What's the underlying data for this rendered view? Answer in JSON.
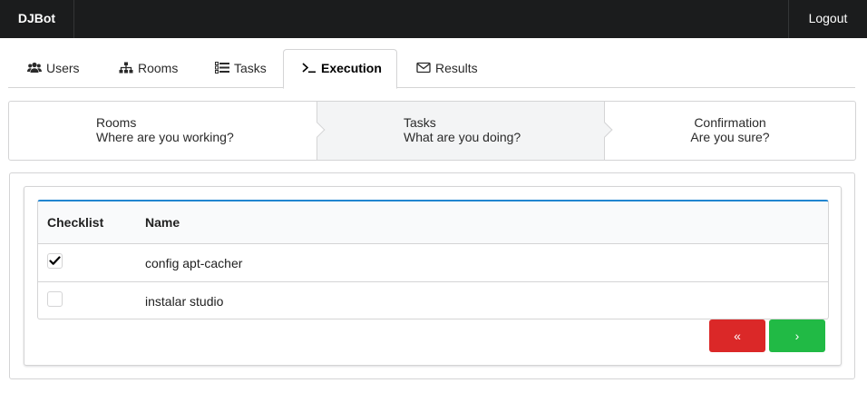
{
  "navbar": {
    "brand": "DJBot",
    "logout_label": "Logout"
  },
  "tabs": [
    {
      "label": "Users",
      "icon": "users-icon"
    },
    {
      "label": "Rooms",
      "icon": "sitemap-icon"
    },
    {
      "label": "Tasks",
      "icon": "tasks-icon"
    },
    {
      "label": "Execution",
      "icon": "terminal-icon",
      "active": true
    },
    {
      "label": "Results",
      "icon": "envelope-icon"
    }
  ],
  "steps": [
    {
      "title": "Rooms",
      "description": "Where are you working?"
    },
    {
      "title": "Tasks",
      "description": "What are you doing?",
      "active": true
    },
    {
      "title": "Confirmation",
      "description": "Are you sure?"
    }
  ],
  "table": {
    "headers": {
      "checklist": "Checklist",
      "name": "Name"
    },
    "rows": [
      {
        "checked": true,
        "name": "config apt-cacher"
      },
      {
        "checked": false,
        "name": "instalar studio"
      }
    ]
  },
  "buttons": {
    "back_label": "«",
    "next_label": "›"
  },
  "colors": {
    "navbar_bg": "#1b1c1d",
    "header_accent": "#2185d0",
    "back_button": "#db2828",
    "next_button": "#21ba45",
    "active_step_bg": "#f3f4f5"
  }
}
